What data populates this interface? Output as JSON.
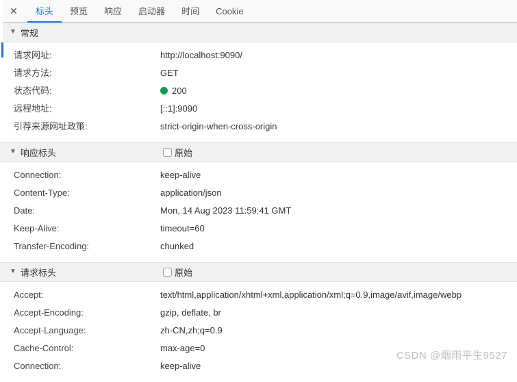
{
  "tabs": {
    "t0": "标头",
    "t1": "预览",
    "t2": "响应",
    "t3": "启动器",
    "t4": "时间",
    "t5": "Cookie"
  },
  "sections": {
    "general": "常规",
    "response": "响应标头",
    "request": "请求标头",
    "raw": "原始"
  },
  "general": {
    "url_label": "请求网址:",
    "url_value": "http://localhost:9090/",
    "method_label": "请求方法:",
    "method_value": "GET",
    "status_label": "状态代码:",
    "status_value": "200",
    "remote_label": "远程地址:",
    "remote_value": "[::1]:9090",
    "referrer_label": "引荐来源网址政策:",
    "referrer_value": "strict-origin-when-cross-origin"
  },
  "response_headers": {
    "connection_label": "Connection:",
    "connection_value": "keep-alive",
    "contenttype_label": "Content-Type:",
    "contenttype_value": "application/json",
    "date_label": "Date:",
    "date_value": "Mon, 14 Aug 2023 11:59:41 GMT",
    "keepalive_label": "Keep-Alive:",
    "keepalive_value": "timeout=60",
    "transfer_label": "Transfer-Encoding:",
    "transfer_value": "chunked"
  },
  "request_headers": {
    "accept_label": "Accept:",
    "accept_value": "text/html,application/xhtml+xml,application/xml;q=0.9,image/avif,image/webp",
    "acceptenc_label": "Accept-Encoding:",
    "acceptenc_value": "gzip, deflate, br",
    "acceptlang_label": "Accept-Language:",
    "acceptlang_value": "zh-CN,zh;q=0.9",
    "cache_label": "Cache-Control:",
    "cache_value": "max-age=0",
    "connection_label": "Connection:",
    "connection_value": "keep-alive"
  },
  "watermark": "CSDN @烟雨平生9527"
}
